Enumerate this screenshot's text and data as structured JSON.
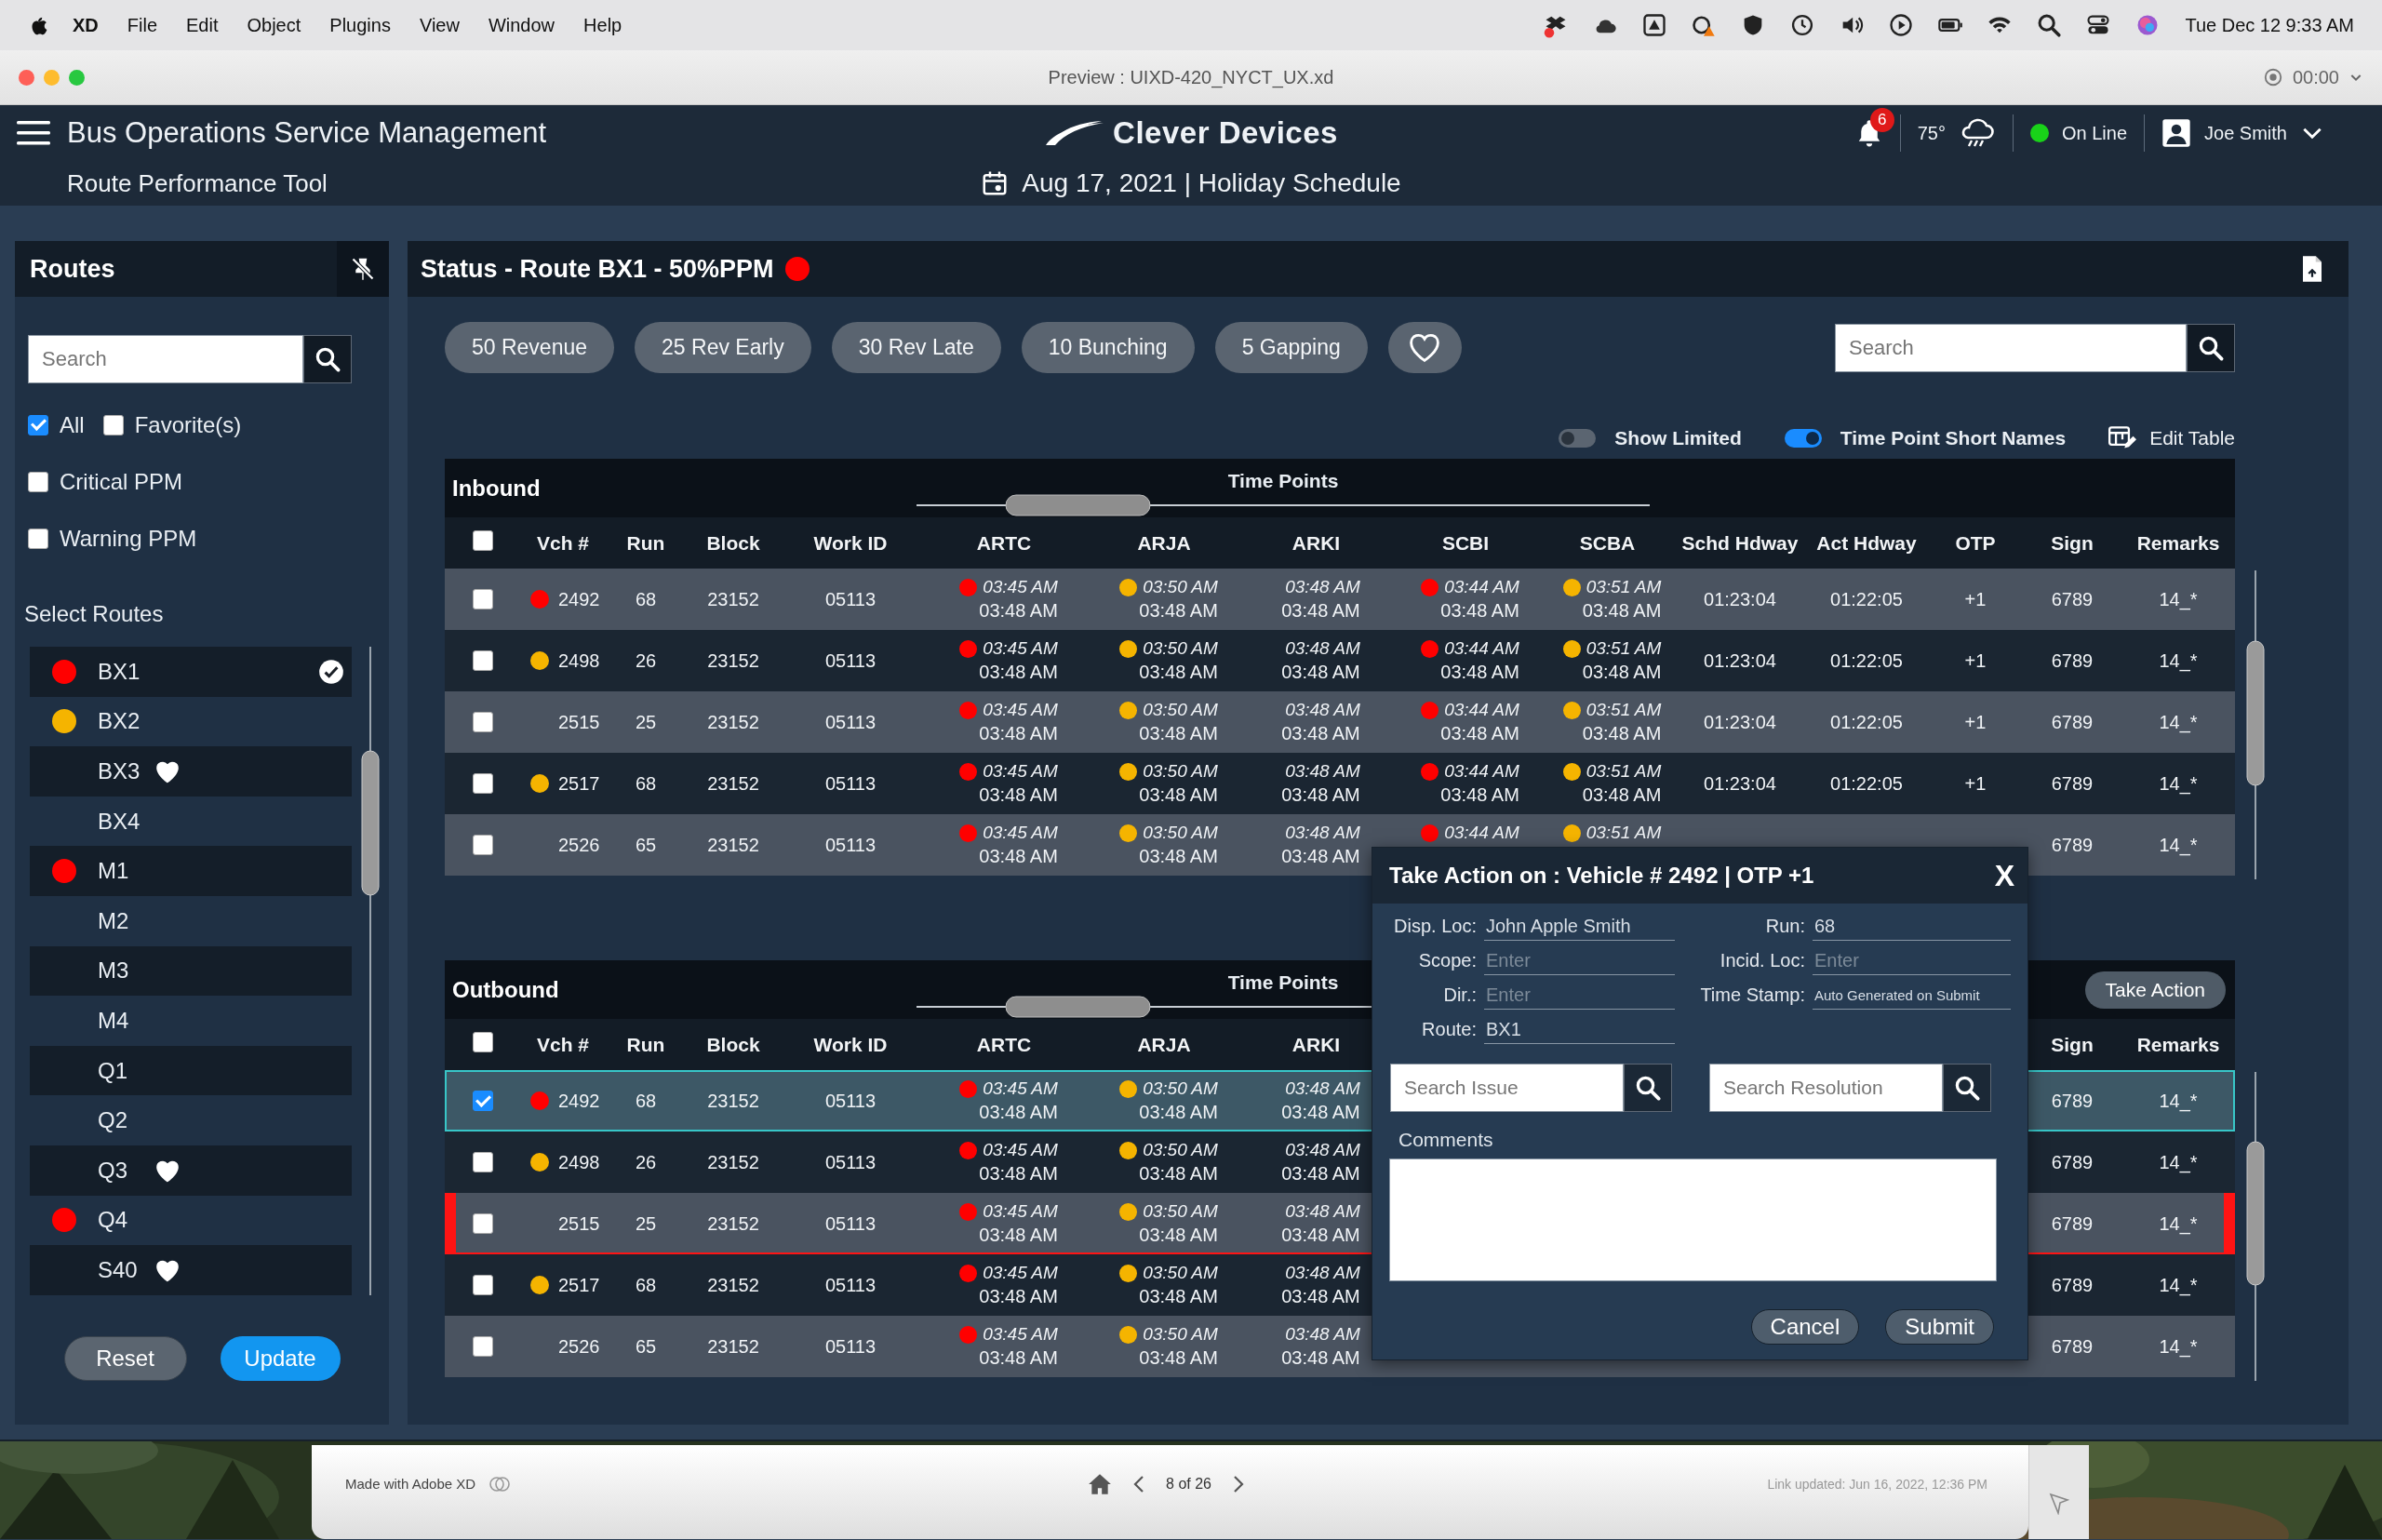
{
  "menu_bar": {
    "app": "XD",
    "items": [
      "File",
      "Edit",
      "Object",
      "Plugins",
      "View",
      "Window",
      "Help"
    ],
    "clock": "Tue Dec 12 9:33 AM"
  },
  "window": {
    "title": "Preview : UIXD-420_NYCT_UX.xd",
    "timer": "00:00"
  },
  "header": {
    "title": "Bus Operations Service Management",
    "subtitle": "Route Performance Tool",
    "logo": "Clever Devices",
    "date": "Aug 17, 2021 | Holiday Schedule",
    "notifications": "6",
    "temperature": "75°",
    "connection": {
      "label": "On Line",
      "color": "#19d219"
    },
    "user": "Joe Smith"
  },
  "routes_panel": {
    "title": "Routes",
    "search": {
      "placeholder": "Search"
    },
    "filter_rows": [
      [
        {
          "label": "All",
          "checked": true
        },
        {
          "label": "Favorite(s)",
          "checked": false
        }
      ],
      [
        {
          "label": "Critical PPM",
          "checked": false
        }
      ],
      [
        {
          "label": "Warning PPM",
          "checked": false
        }
      ]
    ],
    "list_title": "Select Routes",
    "routes": [
      {
        "name": "BX1",
        "color": "#ff0000",
        "favorite": false,
        "selected": true
      },
      {
        "name": "BX2",
        "color": "#f5b400",
        "favorite": false,
        "selected": false
      },
      {
        "name": "BX3",
        "favorite": true,
        "selected": false
      },
      {
        "name": "BX4",
        "favorite": false,
        "selected": false
      },
      {
        "name": "M1",
        "color": "#ff0000",
        "favorite": false,
        "selected": false
      },
      {
        "name": "M2",
        "favorite": false,
        "selected": false
      },
      {
        "name": "M3",
        "favorite": false,
        "selected": false
      },
      {
        "name": "M4",
        "favorite": false,
        "selected": false
      },
      {
        "name": "Q1",
        "favorite": false,
        "selected": false
      },
      {
        "name": "Q2",
        "favorite": false,
        "selected": false
      },
      {
        "name": "Q3",
        "favorite": true,
        "selected": false
      },
      {
        "name": "Q4",
        "color": "#ff0000",
        "favorite": false,
        "selected": false
      },
      {
        "name": "S40",
        "favorite": true,
        "selected": false
      }
    ],
    "buttons": [
      {
        "label": "Reset",
        "kind": "secondary"
      },
      {
        "label": "Update",
        "kind": "primary"
      }
    ]
  },
  "status_panel": {
    "title": "Status - Route BX1 - 50%PPM",
    "color": "#ff0000",
    "chips": [
      "50 Revenue",
      "25 Rev Early",
      "30 Rev Late",
      "10 Bunching",
      "5 Gapping"
    ],
    "search": {
      "placeholder": "Search"
    },
    "toggles": [
      {
        "label": "Show Limited",
        "on": false
      },
      {
        "label": "Time Point Short Names",
        "on": true
      }
    ],
    "edit_table": "Edit Table",
    "tables": [
      {
        "title": "Inbound",
        "group_header": "Time Points",
        "all_checked": false,
        "columns": {
          "vch": "Vch #",
          "run": "Run",
          "block": "Block",
          "work_id": "Work ID",
          "time_points": [
            "ARTC",
            "ARJA",
            "ARKI",
            "SCBI",
            "SCBA"
          ],
          "schd_hdway": "Schd Hdway",
          "act_hdway": "Act Hdway",
          "otp": "OTP",
          "sign": "Sign",
          "remarks": "Remarks"
        },
        "rows": [
          {
            "checked": false,
            "selected": false,
            "flagged": false,
            "color": "#ff0000",
            "vch": "2492",
            "run": "68",
            "block": "23152",
            "work_id": "05113",
            "time_points": [
              {
                "color": "#ff0000",
                "sched": "03:45 AM",
                "actual": "03:48 AM"
              },
              {
                "color": "#f5b400",
                "sched": "03:50 AM",
                "actual": "03:48 AM"
              },
              {
                "sched": "03:48 AM",
                "actual": "03:48 AM"
              },
              {
                "color": "#ff0000",
                "sched": "03:44 AM",
                "actual": "03:48 AM"
              },
              {
                "color": "#f5b400",
                "sched": "03:51 AM",
                "actual": "03:48 AM"
              }
            ],
            "schd_hdway": "01:23:04",
            "act_hdway": "01:22:05",
            "otp": "+1",
            "sign": "6789",
            "remarks": "14_*"
          },
          {
            "checked": false,
            "selected": false,
            "flagged": false,
            "color": "#f5b400",
            "vch": "2498",
            "run": "26",
            "block": "23152",
            "work_id": "05113",
            "time_points": [
              {
                "color": "#ff0000",
                "sched": "03:45 AM",
                "actual": "03:48 AM"
              },
              {
                "color": "#f5b400",
                "sched": "03:50 AM",
                "actual": "03:48 AM"
              },
              {
                "sched": "03:48 AM",
                "actual": "03:48 AM"
              },
              {
                "color": "#ff0000",
                "sched": "03:44 AM",
                "actual": "03:48 AM"
              },
              {
                "color": "#f5b400",
                "sched": "03:51 AM",
                "actual": "03:48 AM"
              }
            ],
            "schd_hdway": "01:23:04",
            "act_hdway": "01:22:05",
            "otp": "+1",
            "sign": "6789",
            "remarks": "14_*"
          },
          {
            "checked": false,
            "selected": false,
            "flagged": false,
            "vch": "2515",
            "run": "25",
            "block": "23152",
            "work_id": "05113",
            "time_points": [
              {
                "color": "#ff0000",
                "sched": "03:45 AM",
                "actual": "03:48 AM"
              },
              {
                "color": "#f5b400",
                "sched": "03:50 AM",
                "actual": "03:48 AM"
              },
              {
                "sched": "03:48 AM",
                "actual": "03:48 AM"
              },
              {
                "color": "#ff0000",
                "sched": "03:44 AM",
                "actual": "03:48 AM"
              },
              {
                "color": "#f5b400",
                "sched": "03:51 AM",
                "actual": "03:48 AM"
              }
            ],
            "schd_hdway": "01:23:04",
            "act_hdway": "01:22:05",
            "otp": "+1",
            "sign": "6789",
            "remarks": "14_*"
          },
          {
            "checked": false,
            "selected": false,
            "flagged": false,
            "color": "#f5b400",
            "vch": "2517",
            "run": "68",
            "block": "23152",
            "work_id": "05113",
            "time_points": [
              {
                "color": "#ff0000",
                "sched": "03:45 AM",
                "actual": "03:48 AM"
              },
              {
                "color": "#f5b400",
                "sched": "03:50 AM",
                "actual": "03:48 AM"
              },
              {
                "sched": "03:48 AM",
                "actual": "03:48 AM"
              },
              {
                "color": "#ff0000",
                "sched": "03:44 AM",
                "actual": "03:48 AM"
              },
              {
                "color": "#f5b400",
                "sched": "03:51 AM",
                "actual": "03:48 AM"
              }
            ],
            "schd_hdway": "01:23:04",
            "act_hdway": "01:22:05",
            "otp": "+1",
            "sign": "6789",
            "remarks": "14_*"
          },
          {
            "checked": false,
            "selected": false,
            "flagged": false,
            "vch": "2526",
            "run": "65",
            "block": "23152",
            "work_id": "05113",
            "time_points": [
              {
                "color": "#ff0000",
                "sched": "03:45 AM",
                "actual": "03:48 AM"
              },
              {
                "color": "#f5b400",
                "sched": "03:50 AM",
                "actual": "03:48 AM"
              },
              {
                "sched": "03:48 AM",
                "actual": "03:48 AM"
              },
              {
                "color": "#ff0000",
                "sched": "03:44 AM"
              },
              {
                "color": "#f5b400",
                "sched": "03:51 AM"
              }
            ],
            "sign": "6789",
            "remarks": "14_*"
          }
        ]
      },
      {
        "title": "Outbound",
        "group_header": "Time Points",
        "all_checked": false,
        "action": "Take Action",
        "columns": {
          "vch": "Vch #",
          "run": "Run",
          "block": "Block",
          "work_id": "Work ID",
          "time_points": [
            "ARTC",
            "ARJA",
            "ARKI"
          ],
          "sign": "Sign",
          "remarks": "Remarks"
        },
        "rows": [
          {
            "checked": true,
            "selected": true,
            "flagged": false,
            "color": "#ff0000",
            "vch": "2492",
            "run": "68",
            "block": "23152",
            "work_id": "05113",
            "time_points": [
              {
                "color": "#ff0000",
                "sched": "03:45 AM",
                "actual": "03:48 AM"
              },
              {
                "color": "#f5b400",
                "sched": "03:50 AM",
                "actual": "03:48 AM"
              },
              {
                "sched": "03:48 AM",
                "actual": "03:48 AM"
              }
            ],
            "sign": "6789",
            "remarks": "14_*"
          },
          {
            "checked": false,
            "selected": false,
            "flagged": false,
            "color": "#f5b400",
            "vch": "2498",
            "run": "26",
            "block": "23152",
            "work_id": "05113",
            "time_points": [
              {
                "color": "#ff0000",
                "sched": "03:45 AM",
                "actual": "03:48 AM"
              },
              {
                "color": "#f5b400",
                "sched": "03:50 AM",
                "actual": "03:48 AM"
              },
              {
                "sched": "03:48 AM",
                "actual": "03:48 AM"
              }
            ],
            "sign": "6789",
            "remarks": "14_*"
          },
          {
            "checked": false,
            "selected": false,
            "flagged": true,
            "vch": "2515",
            "run": "25",
            "block": "23152",
            "work_id": "05113",
            "time_points": [
              {
                "color": "#ff0000",
                "sched": "03:45 AM",
                "actual": "03:48 AM"
              },
              {
                "color": "#f5b400",
                "sched": "03:50 AM",
                "actual": "03:48 AM"
              },
              {
                "sched": "03:48 AM",
                "actual": "03:48 AM"
              }
            ],
            "sign": "6789",
            "remarks": "14_*"
          },
          {
            "checked": false,
            "selected": false,
            "flagged": false,
            "color": "#f5b400",
            "vch": "2517",
            "run": "68",
            "block": "23152",
            "work_id": "05113",
            "time_points": [
              {
                "color": "#ff0000",
                "sched": "03:45 AM",
                "actual": "03:48 AM"
              },
              {
                "color": "#f5b400",
                "sched": "03:50 AM",
                "actual": "03:48 AM"
              },
              {
                "sched": "03:48 AM",
                "actual": "03:48 AM"
              }
            ],
            "sign": "6789",
            "remarks": "14_*"
          },
          {
            "checked": false,
            "selected": false,
            "flagged": false,
            "vch": "2526",
            "run": "65",
            "block": "23152",
            "work_id": "05113",
            "time_points": [
              {
                "color": "#ff0000",
                "sched": "03:45 AM",
                "actual": "03:48 AM"
              },
              {
                "color": "#f5b400",
                "sched": "03:50 AM",
                "actual": "03:48 AM"
              },
              {
                "sched": "03:48 AM",
                "actual": "03:48 AM"
              }
            ],
            "sign": "6789",
            "remarks": "14_*"
          }
        ]
      }
    ]
  },
  "dialog": {
    "title": "Take Action on : Vehicle # 2492 | OTP +1",
    "close": "X",
    "fields": [
      {
        "label": "Disp. Loc:",
        "value": "John Apple Smith",
        "kind": "input"
      },
      {
        "label": "Run:",
        "value": "68",
        "kind": "input"
      },
      {
        "label": "Scope:",
        "placeholder": "Enter",
        "kind": "input"
      },
      {
        "label": "Incid. Loc:",
        "placeholder": "Enter",
        "kind": "input"
      },
      {
        "label": "Dir.:",
        "placeholder": "Enter",
        "kind": "input"
      },
      {
        "label": "Time Stamp:",
        "value": "Auto Generated on Submit",
        "kind": "note"
      },
      {
        "label": "Route:",
        "value": "BX1",
        "kind": "input"
      }
    ],
    "searches": [
      {
        "placeholder": "Search Issue"
      },
      {
        "placeholder": "Search Resolution"
      }
    ],
    "comments_label": "Comments",
    "buttons": [
      "Cancel",
      "Submit"
    ]
  },
  "footer": {
    "credit": "Made with Adobe XD",
    "page": "8 of 26",
    "updated": "Link updated: Jun 16, 2022, 12:36 PM"
  }
}
